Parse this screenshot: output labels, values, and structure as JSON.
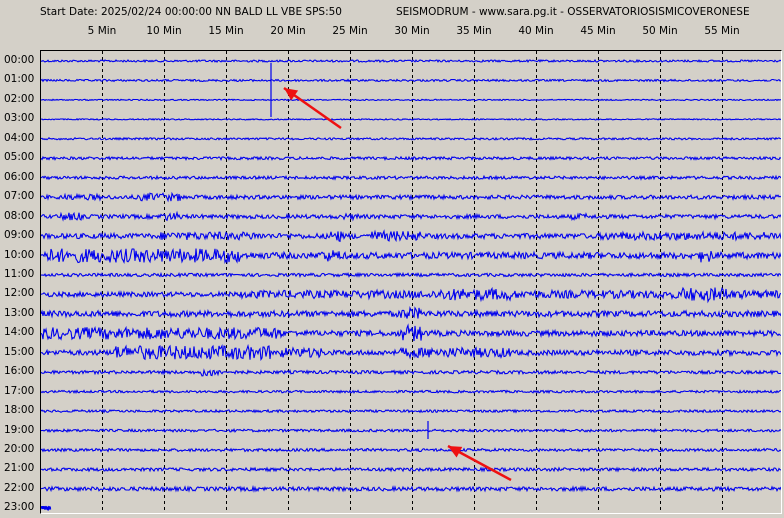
{
  "header": {
    "title_left": "Start Date: 2025/02/24 00:00:00 NN BALD LL VBE SPS:50",
    "title_right": "SEISMODRUM - www.sara.pg.it - OSSERVATORIOSISMICOVERONESE"
  },
  "minute_labels": [
    "5 Min",
    "10 Min",
    "15 Min",
    "20 Min",
    "25 Min",
    "30 Min",
    "35 Min",
    "40 Min",
    "45 Min",
    "50 Min",
    "55 Min"
  ],
  "hour_labels": [
    "00:00",
    "01:00",
    "02:00",
    "03:00",
    "04:00",
    "05:00",
    "06:00",
    "07:00",
    "08:00",
    "09:00",
    "10:00",
    "11:00",
    "12:00",
    "13:00",
    "14:00",
    "15:00",
    "16:00",
    "17:00",
    "18:00",
    "19:00",
    "20:00",
    "21:00",
    "22:00",
    "23:00"
  ],
  "colors": {
    "trace": "#0000ee",
    "arrow": "#ee1111",
    "grid": "#000000",
    "background": "#d4d0c8"
  },
  "icons": [
    "arrow-annotation-icon"
  ]
}
